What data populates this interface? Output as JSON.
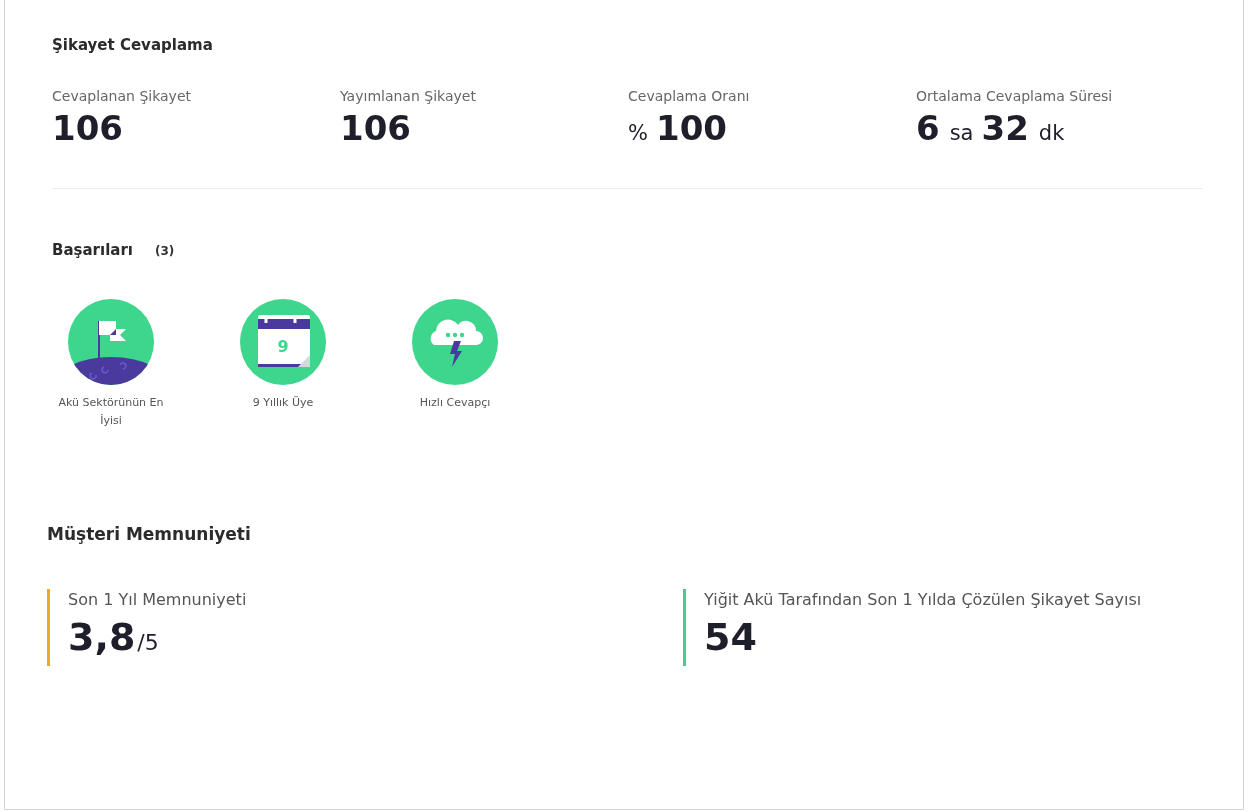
{
  "complaint_answering": {
    "title": "Şikayet Cevaplama",
    "stats": [
      {
        "label": "Cevaplanan Şikayet",
        "value": [
          {
            "text": "106",
            "kind": "big"
          }
        ]
      },
      {
        "label": "Yayımlanan Şikayet",
        "value": [
          {
            "text": "106",
            "kind": "big"
          }
        ]
      },
      {
        "label": "Cevaplama Oranı",
        "value": [
          {
            "text": "%",
            "kind": "small"
          },
          {
            "text": "100",
            "kind": "big"
          }
        ]
      },
      {
        "label": "Ortalama Cevaplama Süresi",
        "value": [
          {
            "text": "6",
            "kind": "big"
          },
          {
            "text": "sa",
            "kind": "small"
          },
          {
            "text": "32",
            "kind": "big"
          },
          {
            "text": "dk",
            "kind": "small"
          }
        ]
      }
    ]
  },
  "achievements": {
    "title": "Başarıları",
    "count": "(3)",
    "badges": [
      {
        "kind": "flag",
        "label": "Akü Sektörünün En İyisi"
      },
      {
        "kind": "calendar",
        "number": "9",
        "label": "9 Yıllık Üye"
      },
      {
        "kind": "cloud",
        "label": "Hızlı Cevapçı"
      }
    ]
  },
  "satisfaction": {
    "title": "Müşteri Memnuniyeti",
    "metrics": [
      {
        "label": "Son 1 Yıl Memnuniyeti",
        "value": "3,8",
        "suffix": "/5",
        "color": "#f5a623"
      },
      {
        "label": "Yiğit Akü Tarafından Son 1 Yılda Çözülen Şikayet Sayısı",
        "value": "54",
        "color": "#3ecf8e"
      }
    ]
  }
}
